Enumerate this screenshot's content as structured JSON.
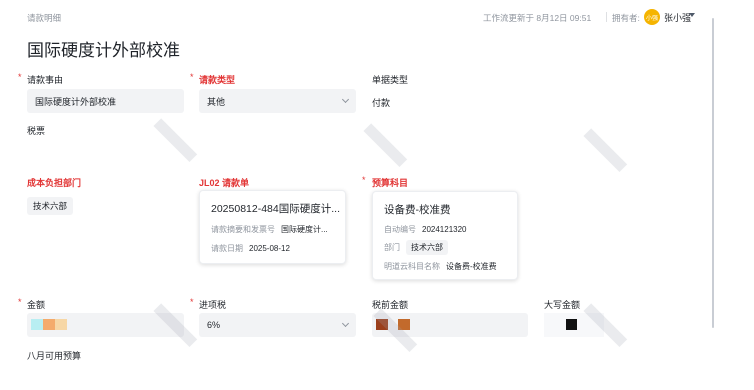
{
  "header": {
    "breadcrumb": "请款明细",
    "updated_text": "工作流更新于 8月12日 09:51",
    "owner_label": "拥有者:",
    "owner_avatar_text": "小强",
    "owner_name": "张小强"
  },
  "page_title": "国际硬度计外部校准",
  "fields": {
    "reason": {
      "label": "请款事由",
      "value": "国际硬度计外部校准"
    },
    "request_type": {
      "label": "请款类型",
      "value": "其他"
    },
    "doc_type": {
      "label": "单据类型",
      "value": "付款"
    },
    "tax_ticket": {
      "label": "税票"
    },
    "cost_dept": {
      "label": "成本负担部门",
      "tag": "技术六部"
    },
    "jl02": {
      "label": "JL02 请款单",
      "card_title": "20250812-484国际硬度计...",
      "row1_key": "请款摘要和发票号",
      "row1_val": "国际硬度计...",
      "row2_key": "请款日期",
      "row2_val": "2025-08-12"
    },
    "budget": {
      "label": "预算科目",
      "card_title": "设备费-校准费",
      "row1_key": "自动编号",
      "row1_val": "2024121320",
      "row2_key": "部门",
      "row2_val": "技术六部",
      "row3_key": "明道云科目名称",
      "row3_val": "设备费-校准费"
    },
    "amount": {
      "label": "金额"
    },
    "input_tax": {
      "label": "进项税",
      "value": "6%"
    },
    "pretax_amount": {
      "label": "税前金额"
    },
    "amount_upper": {
      "label": "大写金额"
    },
    "august_budget": {
      "label": "八月可用预算"
    }
  },
  "colors": {
    "required": "#e23636",
    "avatar": "#f5b400",
    "swatch_cyan": "#b8eef2",
    "swatch_orange": "#f4ab6c",
    "swatch_peach": "#f7d7a6",
    "swatch_brown1": "#9b3f1c",
    "swatch_brown2": "#c26a2c",
    "swatch_black": "#111111"
  }
}
